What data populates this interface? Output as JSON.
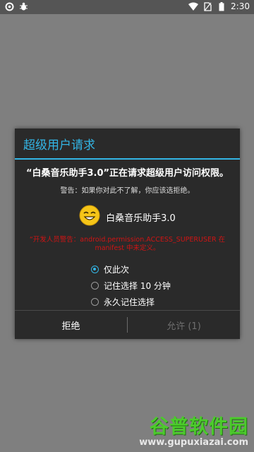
{
  "status_bar": {
    "time": "2:30",
    "left_icons": [
      "settings-icon",
      "bug-icon"
    ],
    "right_icons": [
      "wifi-icon",
      "no-sim-icon",
      "battery-icon"
    ]
  },
  "dialog": {
    "title": "超级用户请求",
    "headline": "“白桑音乐助手3.0”正在请求超级用户访问权限。",
    "warning": "警告：如果你对此不了解，你应该选拒绝。",
    "app_icon": "smiley-face-icon",
    "app_name": "白桑音乐助手3.0",
    "dev_warning": "“开发人员警告：android.permission.ACCESS_SUPERUSER 在 manifest 中未定义。",
    "options": [
      {
        "label": "仅此次",
        "selected": true
      },
      {
        "label": "记住选择 10 分钟",
        "selected": false
      },
      {
        "label": "永久记住选择",
        "selected": false
      }
    ],
    "buttons": {
      "deny": "拒绝",
      "allow": "允许 (1)"
    }
  },
  "watermark": {
    "brand": "谷普软件园",
    "url": "www.gupuxiazai.com"
  },
  "colors": {
    "accent": "#33b5e5",
    "warning_red": "#d01414",
    "dialog_bg": "#2a2a2a",
    "scrim": "#7f7f7f"
  }
}
